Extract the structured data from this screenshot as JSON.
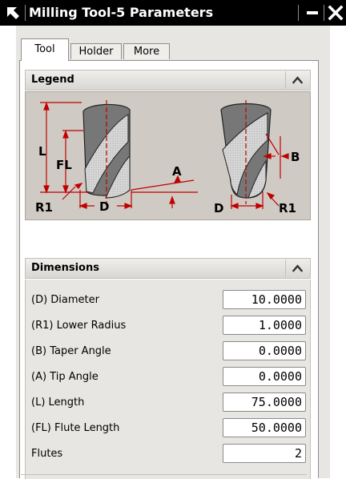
{
  "window": {
    "title": "Milling Tool-5 Parameters",
    "icon": "cursor-arrow-icon",
    "minimize_icon": "minimize-icon",
    "close_icon": "close-icon"
  },
  "tabs": [
    {
      "label": "Tool",
      "active": true
    },
    {
      "label": "Holder",
      "active": false
    },
    {
      "label": "More",
      "active": false
    }
  ],
  "legend": {
    "header": "Legend",
    "labels": {
      "L": "L",
      "FL": "FL",
      "A": "A",
      "R1_left": "R1",
      "D_left": "D",
      "B": "B",
      "D_right": "D",
      "R1_right": "R1"
    }
  },
  "dimensions": {
    "header": "Dimensions",
    "fields": [
      {
        "label": "(D) Diameter",
        "value": "10.0000"
      },
      {
        "label": "(R1) Lower Radius",
        "value": "1.0000"
      },
      {
        "label": "(B) Taper Angle",
        "value": "0.0000"
      },
      {
        "label": "(A) Tip Angle",
        "value": "0.0000"
      },
      {
        "label": "(L) Length",
        "value": "75.0000"
      },
      {
        "label": "(FL) Flute Length",
        "value": "50.0000"
      },
      {
        "label": "Flutes",
        "value": "2"
      }
    ]
  },
  "colors": {
    "titlebar": "#000000",
    "dialog_bg": "#e8e6e2",
    "legend_bg": "#cfcbc4",
    "tool_body": "#7a7a7a",
    "dim_lines": "#c00000"
  }
}
